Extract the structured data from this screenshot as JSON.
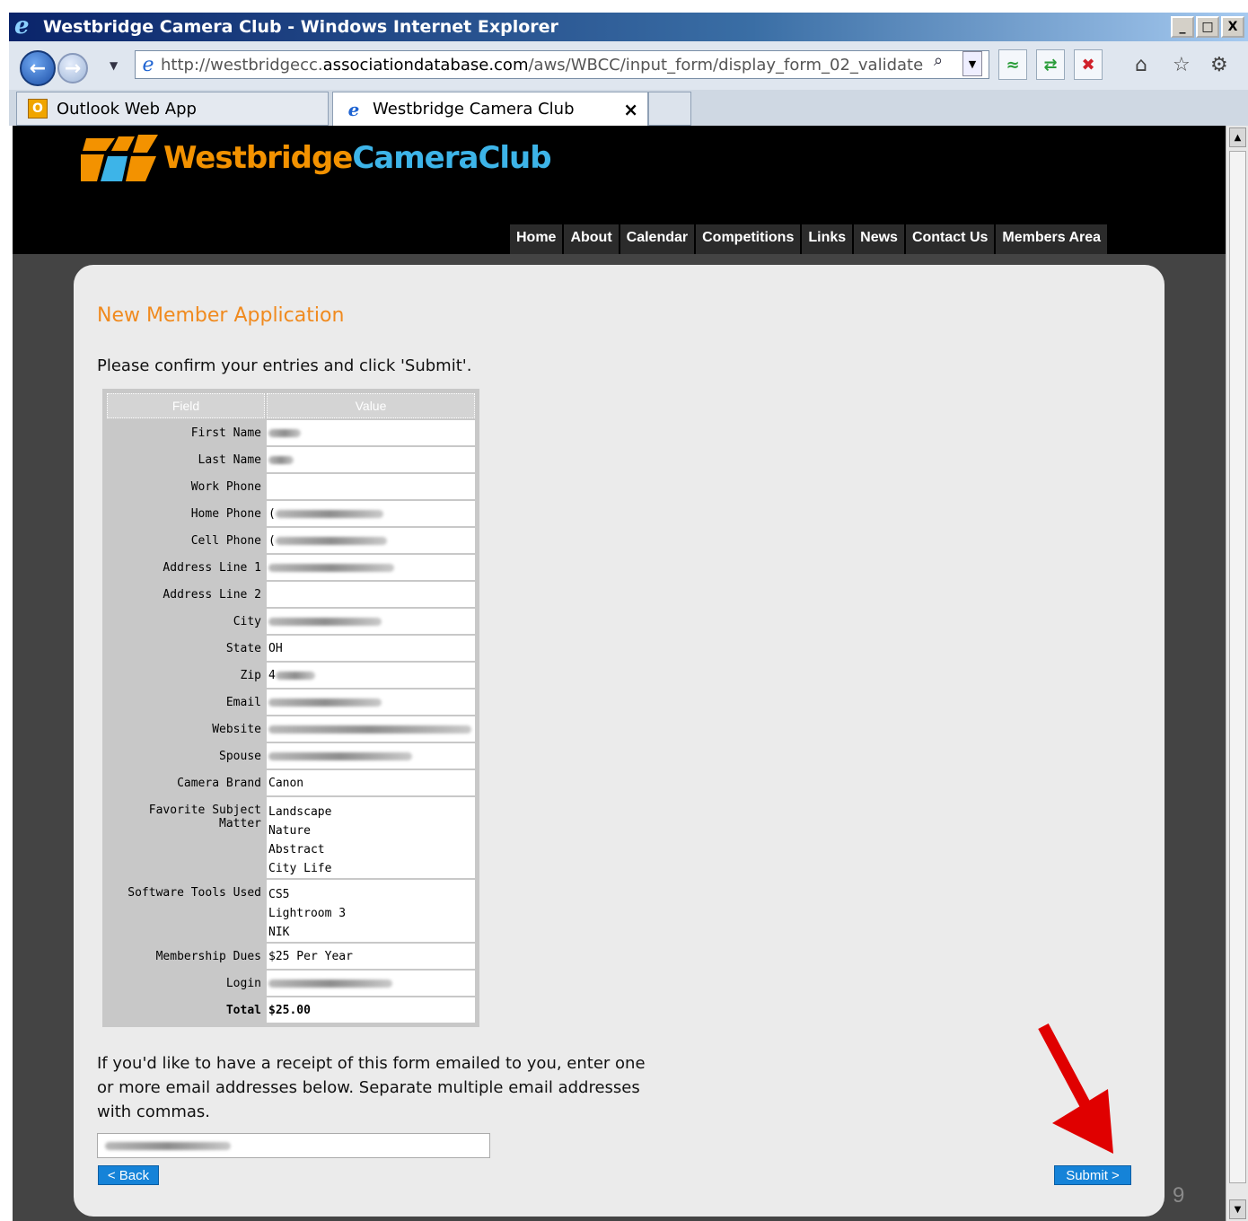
{
  "window": {
    "title": "Westbridge Camera Club - Windows Internet Explorer",
    "controls": [
      "_",
      "□",
      "X"
    ]
  },
  "address_bar": {
    "url_prefix": "http://westbridgecc.",
    "url_domain": "associationdatabase.com",
    "url_path": "/aws/WBCC/input_form/display_form_02_validate"
  },
  "tabs": [
    {
      "label": "Outlook Web App",
      "icon": "outlook-icon"
    },
    {
      "label": "Westbridge Camera Club",
      "icon": "ie-page-icon",
      "close": "×"
    }
  ],
  "site": {
    "logo_word1": "Westbridge",
    "logo_word2": "CameraClub",
    "brand_orange": "#f39200",
    "brand_blue": "#3db4e8",
    "nav": [
      "Home",
      "About",
      "Calendar",
      "Competitions",
      "Links",
      "News",
      "Contact Us",
      "Members Area"
    ]
  },
  "form": {
    "title": "New Member Application",
    "intro": "Please confirm your entries and click 'Submit'.",
    "columns": [
      "Field",
      "Value"
    ],
    "rows": [
      {
        "field": "First Name",
        "value": "",
        "redacted": true
      },
      {
        "field": "Last Name",
        "value": "",
        "redacted": true
      },
      {
        "field": "Work Phone",
        "value": ""
      },
      {
        "field": "Home Phone",
        "value": "(",
        "redacted": true
      },
      {
        "field": "Cell Phone",
        "value": "(",
        "redacted": true
      },
      {
        "field": "Address Line 1",
        "value": "",
        "redacted": true
      },
      {
        "field": "Address Line 2",
        "value": ""
      },
      {
        "field": "City",
        "value": "",
        "redacted": true
      },
      {
        "field": "State",
        "value": "OH"
      },
      {
        "field": "Zip",
        "value": "4",
        "redacted": true
      },
      {
        "field": "Email",
        "value": "",
        "redacted": true
      },
      {
        "field": "Website",
        "value": "",
        "redacted": true
      },
      {
        "field": "Spouse",
        "value": "",
        "redacted": true
      },
      {
        "field": "Camera Brand",
        "value": "Canon"
      },
      {
        "field": "Favorite Subject Matter",
        "values": [
          "Landscape",
          "Nature",
          "Abstract",
          "City Life"
        ]
      },
      {
        "field": "Software Tools Used",
        "values": [
          "CS5",
          "Lightroom 3",
          "NIK"
        ]
      },
      {
        "field": "Membership Dues",
        "value": "$25 Per Year"
      },
      {
        "field": "Login",
        "value": "",
        "redacted": true
      },
      {
        "field": "Total",
        "value": "$25.00",
        "bold": true
      }
    ],
    "receipt_note": "If you'd like to have a receipt of this form emailed to you, enter one or more email addresses below. Separate multiple email addresses with commas.",
    "back_label": "< Back",
    "submit_label": "Submit >"
  },
  "slide_number": "9",
  "annotation_color": "#e00000"
}
